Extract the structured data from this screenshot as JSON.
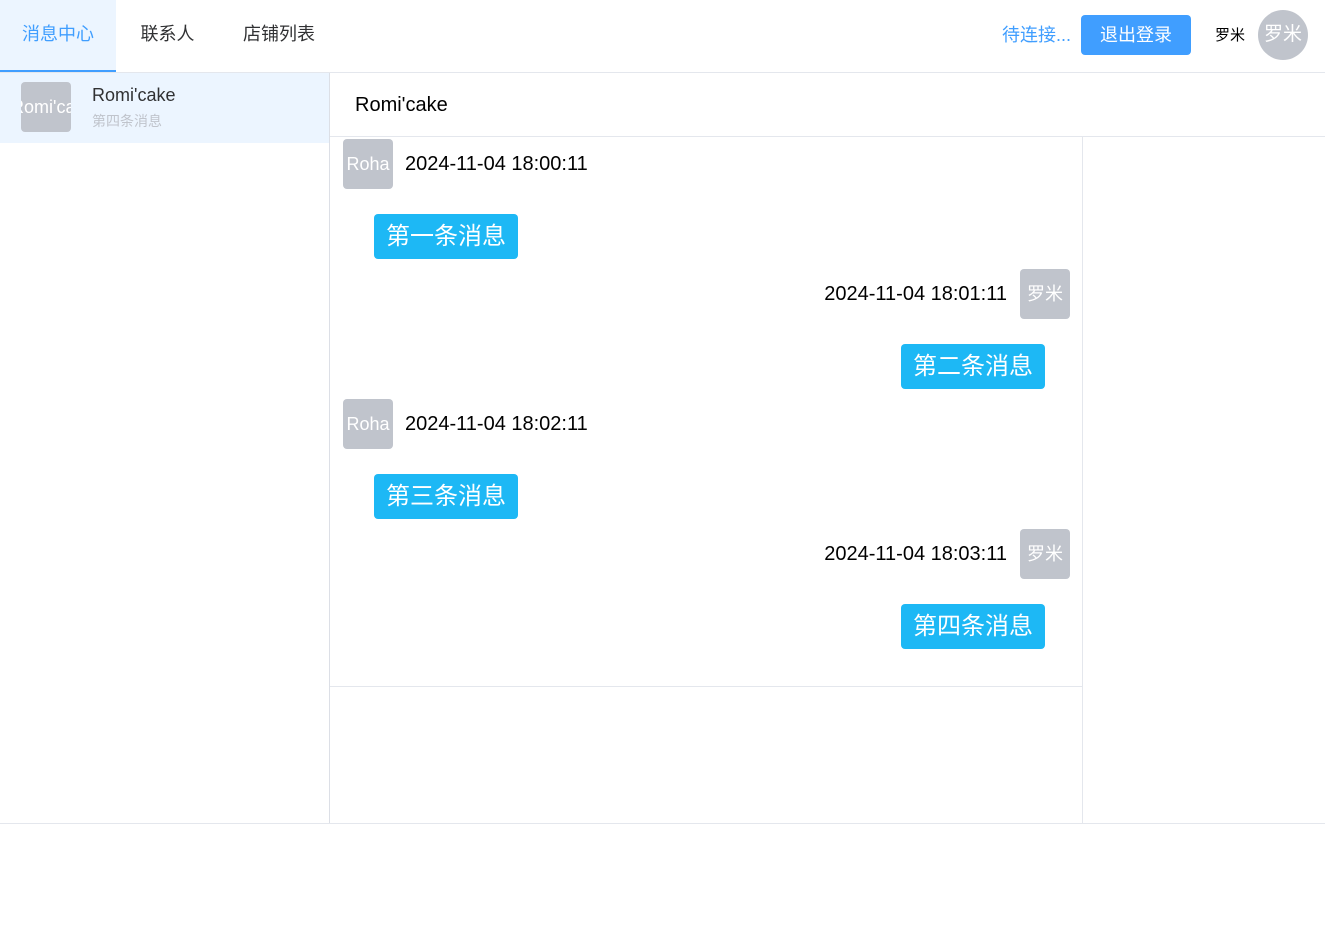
{
  "nav": {
    "tabs": [
      {
        "label": "消息中心",
        "active": true
      },
      {
        "label": "联系人",
        "active": false
      },
      {
        "label": "店铺列表",
        "active": false
      }
    ],
    "connection_status": "待连接...",
    "logout_label": "退出登录",
    "username": "罗米",
    "avatar_text": "罗米"
  },
  "sidebar": {
    "conversations": [
      {
        "avatar_text": "Romi'cake",
        "name": "Romi'cake",
        "preview": "第四条消息",
        "selected": true
      }
    ]
  },
  "chat": {
    "title": "Romi'cake",
    "messages": [
      {
        "side": "left",
        "avatar_text": "Roha",
        "time": "2024-11-04 18:00:11",
        "text": "第一条消息"
      },
      {
        "side": "right",
        "avatar_text": "罗米",
        "time": "2024-11-04 18:01:11",
        "text": "第二条消息"
      },
      {
        "side": "left",
        "avatar_text": "Roha",
        "time": "2024-11-04 18:02:11",
        "text": "第三条消息"
      },
      {
        "side": "right",
        "avatar_text": "罗米",
        "time": "2024-11-04 18:03:11",
        "text": "第四条消息"
      }
    ]
  },
  "colors": {
    "primary": "#409eff",
    "active_tab_bg": "#ecf5ff",
    "bubble": "#1db8f5",
    "avatar_bg": "#c0c4cc"
  }
}
